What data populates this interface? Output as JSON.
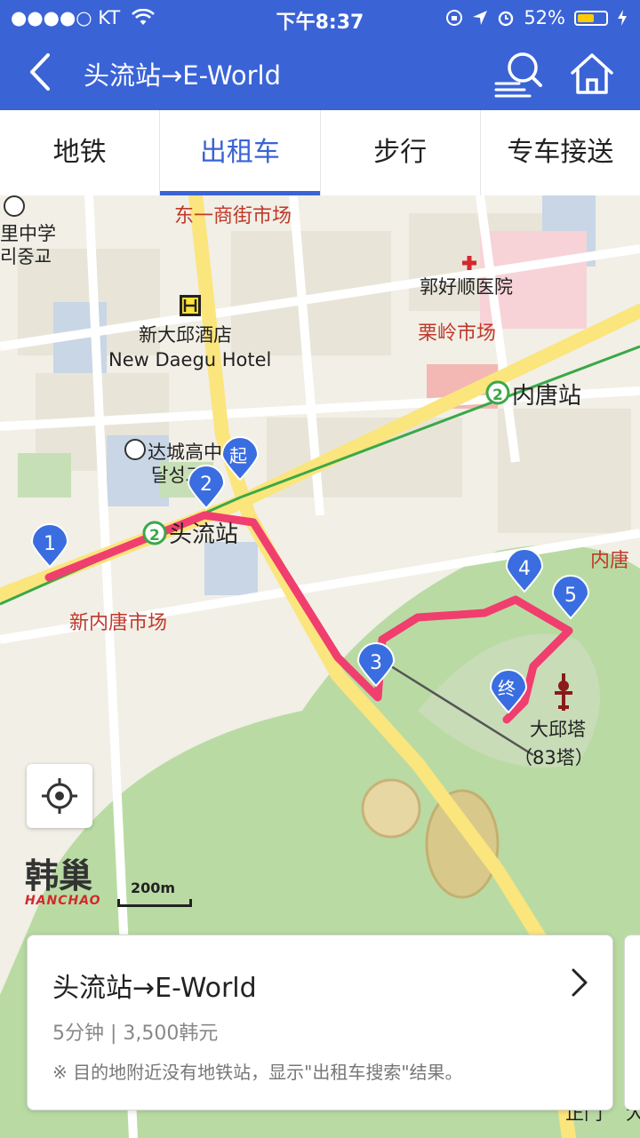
{
  "status": {
    "carrier": "●●●●○ KT",
    "time": "下午8:37",
    "battery": "52%"
  },
  "nav": {
    "title": "头流站→E-World"
  },
  "tabs": [
    {
      "label": "地铁"
    },
    {
      "label": "出租车"
    },
    {
      "label": "步行"
    },
    {
      "label": "专车接送"
    }
  ],
  "map": {
    "labels": {
      "market1": "东一商街市场",
      "school_cn": "里中学",
      "school_kr": "리중교",
      "hotel_cn": "新大邱酒店",
      "hotel_en": "New Daegu Hotel",
      "hospital": "郭好顺医院",
      "market2": "栗岭市场",
      "station_neitang": "内唐站",
      "school2_cn": "达城高中",
      "school2_kr": "달성고",
      "station_touliu": "头流站",
      "neitang_right": "内唐",
      "market3": "新内唐市场",
      "tower_cn": "大邱塔",
      "tower_sub": "（83塔）",
      "gate": "正门",
      "gate2": "大",
      "line_no": "2"
    },
    "markers": {
      "start": "起",
      "end": "终",
      "m1": "1",
      "m2": "2",
      "m3": "3",
      "m4": "4",
      "m5": "5"
    },
    "colors": {
      "route": "#f03e6e",
      "marker": "#3a6de0",
      "park": "#b9dba3",
      "road": "#fbe57d"
    },
    "logo_cn": "韩巢",
    "logo_en": "HANCHAO",
    "scale": "200m"
  },
  "card": {
    "title": "头流站→E-World",
    "meta": "5分钟 | 3,500韩元",
    "note": "※ 目的地附近没有地铁站，显示\"出租车搜索\"结果。"
  }
}
